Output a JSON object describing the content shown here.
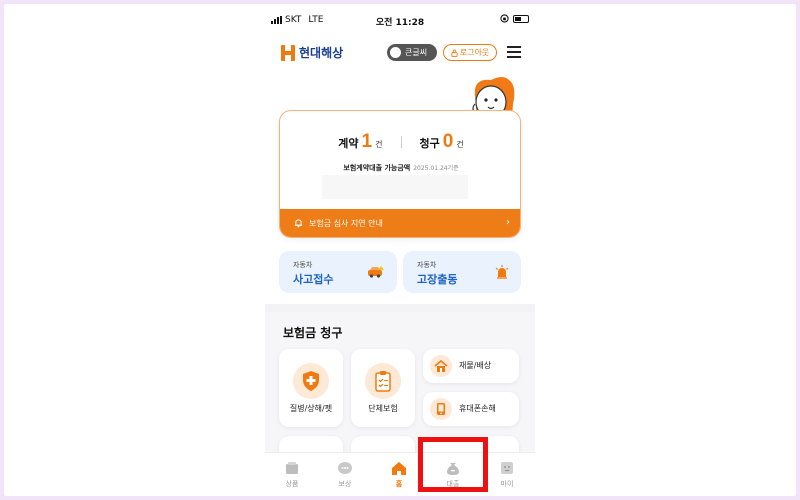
{
  "status_bar": {
    "carrier": "SKT",
    "network": "LTE",
    "time": "오전 11:28"
  },
  "header": {
    "logo_text": "현대해상",
    "bigfont_label": "큰글씨",
    "logout_label": "로그아웃"
  },
  "summary": {
    "contract_label": "계약",
    "contract_count": "1",
    "contract_unit": "건",
    "claim_label": "청구",
    "claim_count": "0",
    "claim_unit": "건",
    "loan_label": "보험계약대출 가능금액",
    "loan_date": "2025.01.24기준",
    "notice_text": "보험금 심사 지연 안내"
  },
  "quick_actions": [
    {
      "sub": "자동차",
      "main": "사고접수"
    },
    {
      "sub": "자동차",
      "main": "고장출동"
    }
  ],
  "claims": {
    "title": "보험금 청구",
    "big_tiles": [
      {
        "label": "질병/상해/펫"
      },
      {
        "label": "단체보험"
      }
    ],
    "small_tiles": [
      {
        "label": "재물/배상"
      },
      {
        "label": "휴대폰손해"
      }
    ]
  },
  "tabbar": {
    "items": [
      {
        "label": "상품"
      },
      {
        "label": "보상"
      },
      {
        "label": "홈"
      },
      {
        "label": "대출"
      },
      {
        "label": "마이"
      }
    ],
    "active": "홈"
  },
  "colors": {
    "brand_orange": "#f07a12",
    "brand_blue": "#1b3f8f",
    "highlight_red": "#ee1111",
    "quick_blue": "#1e63c9"
  }
}
